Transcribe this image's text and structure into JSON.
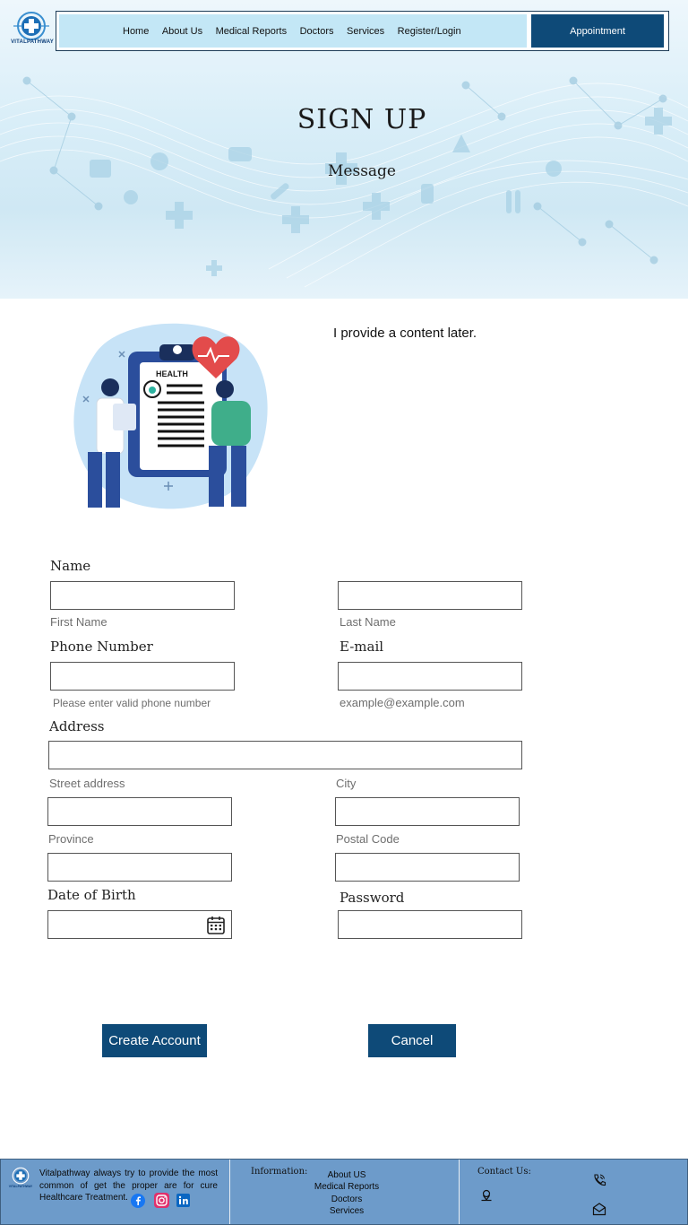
{
  "brand": {
    "name": "VITALPATHWAY",
    "tagline": "MEDICAL CARE"
  },
  "nav": {
    "items": [
      "Home",
      "About Us",
      "Medical Reports",
      "Doctors",
      "Services",
      "Register/Login"
    ],
    "appointment_label": "Appointment"
  },
  "hero": {
    "title": "SIGN UP",
    "subtitle": "Message"
  },
  "intro": {
    "text": "I provide a content later.",
    "illustration_label": "HEALTH"
  },
  "form": {
    "name_label": "Name",
    "first_name_hint": "First Name",
    "last_name_hint": "Last Name",
    "phone_label": "Phone Number",
    "phone_hint": "Please enter valid phone number",
    "email_label": "E-mail",
    "email_hint": "example@example.com",
    "address_label": "Address",
    "street_hint": "Street address",
    "city_hint": "City",
    "province_hint": "Province",
    "postal_hint": "Postal Code",
    "dob_label": "Date of Birth",
    "password_label": "Password"
  },
  "actions": {
    "create_label": "Create Account",
    "cancel_label": "Cancel"
  },
  "footer": {
    "about": "Vitalpathway always try to provide the most common of get the proper are for cure Healthcare Treatment.",
    "info_heading": "Information:",
    "info_links": [
      "About US",
      "Medical Reports",
      "Doctors",
      "Services"
    ],
    "contact_heading": "Contact Us:"
  },
  "icons": [
    "logo-icon",
    "calendar-icon",
    "facebook-icon",
    "instagram-icon",
    "linkedin-icon",
    "location-icon",
    "phone-icon",
    "mail-icon"
  ],
  "colors": {
    "primary": "#0e4a78",
    "nav_bg": "#c3e7f6",
    "footer_bg": "#6d9bca"
  }
}
